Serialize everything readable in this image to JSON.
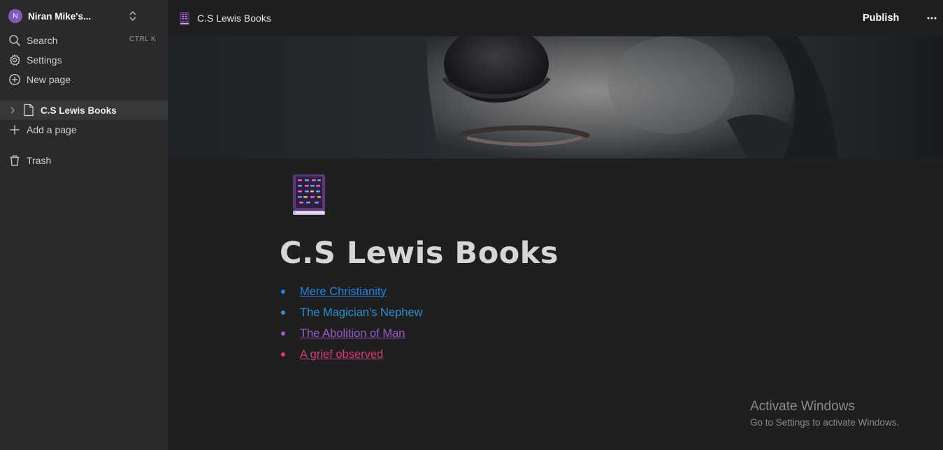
{
  "sidebar": {
    "workspace": {
      "avatar_letter": "N",
      "name": "Niran Mike's..."
    },
    "nav": [
      {
        "label": "Search",
        "shortcut": "CTRL K",
        "icon": "search-icon"
      },
      {
        "label": "Settings",
        "icon": "gear-icon"
      },
      {
        "label": "New page",
        "icon": "plus-circle-icon"
      }
    ],
    "pages": [
      {
        "label": "C.S Lewis Books",
        "icon": "document-icon"
      }
    ],
    "add_page_label": "Add a page",
    "trash_label": "Trash"
  },
  "topbar": {
    "page_title": "C.S Lewis Books",
    "publish_label": "Publish"
  },
  "page": {
    "icon": "book-emoji",
    "title": "C.S Lewis Books",
    "books": [
      {
        "label": "Mere Christianity",
        "color": "#2383e2",
        "underline": true
      },
      {
        "label": "The Magician's Nephew",
        "color": "#2f8fd0",
        "underline": false
      },
      {
        "label": "The Abolition of Man",
        "color": "#9b59d0",
        "underline": true
      },
      {
        "label": "A grief observed",
        "color": "#d63a7a",
        "underline": true
      }
    ]
  },
  "watermark": {
    "title": "Activate Windows",
    "subtitle": "Go to Settings to activate Windows."
  },
  "colors": {
    "background": "#1f1f1f",
    "sidebar": "#2a2a2a",
    "selected_page": "#383838",
    "avatar": "#7d5bbe"
  }
}
